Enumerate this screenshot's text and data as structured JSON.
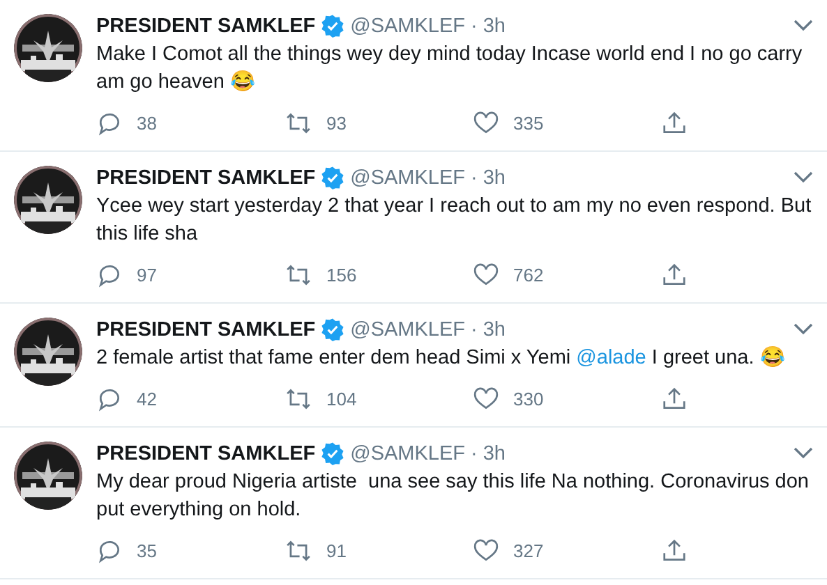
{
  "tweets": [
    {
      "name": "PRESIDENT SAMKLEF",
      "verified": true,
      "handle": "@SAMKLEF",
      "separator": "·",
      "time": "3h",
      "text": [
        {
          "kind": "plain",
          "text": "Make I Comot all the things wey dey mind today Incase world end I no go carry am go heaven 😂"
        }
      ],
      "replies": "38",
      "retweets": "93",
      "likes": "335"
    },
    {
      "name": "PRESIDENT SAMKLEF",
      "verified": true,
      "handle": "@SAMKLEF",
      "separator": "·",
      "time": "3h",
      "text": [
        {
          "kind": "plain",
          "text": "Ycee wey start yesterday 2 that year I reach out to am my no even respond. But this life sha"
        }
      ],
      "replies": "97",
      "retweets": "156",
      "likes": "762"
    },
    {
      "name": "PRESIDENT SAMKLEF",
      "verified": true,
      "handle": "@SAMKLEF",
      "separator": "·",
      "time": "3h",
      "text": [
        {
          "kind": "plain",
          "text": "2 female artist that fame enter dem head Simi x Yemi "
        },
        {
          "kind": "mention",
          "text": "@alade"
        },
        {
          "kind": "plain",
          "text": " I greet una. 😂"
        }
      ],
      "replies": "42",
      "retweets": "104",
      "likes": "330"
    },
    {
      "name": "PRESIDENT SAMKLEF",
      "verified": true,
      "handle": "@SAMKLEF",
      "separator": "·",
      "time": "3h",
      "text": [
        {
          "kind": "plain",
          "text": "My dear proud Nigeria artiste  una see say this life Na nothing. Coronavirus don put everything on hold."
        }
      ],
      "replies": "35",
      "retweets": "91",
      "likes": "327"
    }
  ]
}
